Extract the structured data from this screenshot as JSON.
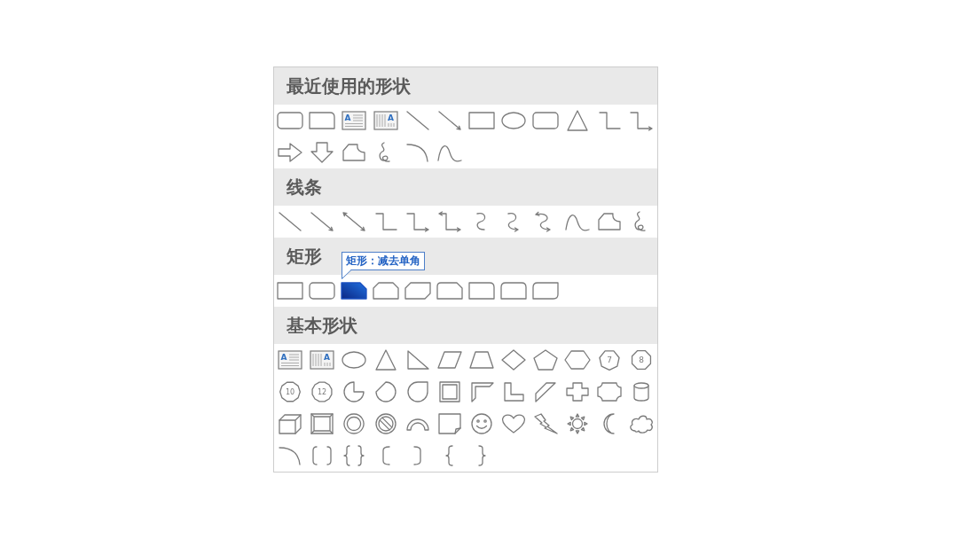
{
  "sections": [
    {
      "title": "最近使用的形状",
      "shapes": [
        {
          "kind": "roundrect",
          "selected": false
        },
        {
          "kind": "round1",
          "selected": false
        },
        {
          "kind": "textbox",
          "label": "A",
          "selected": false
        },
        {
          "kind": "vtextbox",
          "label": "A",
          "selected": false
        },
        {
          "kind": "line",
          "selected": false
        },
        {
          "kind": "arrow",
          "selected": false
        },
        {
          "kind": "rect",
          "selected": false
        },
        {
          "kind": "ellipse",
          "selected": false
        },
        {
          "kind": "roundrect",
          "selected": false
        },
        {
          "kind": "triangle",
          "selected": false
        },
        {
          "kind": "elbow",
          "selected": false
        },
        {
          "kind": "elbowarrow",
          "selected": false
        },
        {
          "kind": "rightarrow",
          "selected": false
        },
        {
          "kind": "downarrow",
          "selected": false
        },
        {
          "kind": "freeform",
          "selected": false
        },
        {
          "kind": "scribble",
          "selected": false
        },
        {
          "kind": "arc",
          "selected": false
        },
        {
          "kind": "curve",
          "selected": false
        }
      ]
    },
    {
      "title": "线条",
      "shapes": [
        {
          "kind": "line",
          "selected": false
        },
        {
          "kind": "arrow",
          "selected": false
        },
        {
          "kind": "doublearrow",
          "selected": false
        },
        {
          "kind": "elbow",
          "selected": false
        },
        {
          "kind": "elbowarrow",
          "selected": false
        },
        {
          "kind": "elbowdouble",
          "selected": false
        },
        {
          "kind": "curvedconn",
          "selected": false
        },
        {
          "kind": "curvedarrow",
          "selected": false
        },
        {
          "kind": "curveddouble",
          "selected": false
        },
        {
          "kind": "curve",
          "selected": false
        },
        {
          "kind": "freeform",
          "selected": false
        },
        {
          "kind": "scribble",
          "selected": false
        }
      ]
    },
    {
      "title": "矩形",
      "shapes": [
        {
          "kind": "rect",
          "selected": false
        },
        {
          "kind": "roundrect",
          "selected": false
        },
        {
          "kind": "snip1",
          "selected": true
        },
        {
          "kind": "snipsame",
          "selected": false
        },
        {
          "kind": "snipdiag",
          "selected": false
        },
        {
          "kind": "snipround",
          "selected": false
        },
        {
          "kind": "round1",
          "selected": false
        },
        {
          "kind": "round2same",
          "selected": false
        },
        {
          "kind": "round2diag",
          "selected": false
        }
      ]
    },
    {
      "title": "基本形状",
      "shapes": [
        {
          "kind": "textbox",
          "label": "A",
          "selected": false
        },
        {
          "kind": "vtextbox",
          "label": "A",
          "selected": false
        },
        {
          "kind": "ellipse",
          "selected": false
        },
        {
          "kind": "triangle",
          "selected": false
        },
        {
          "kind": "righttriangle",
          "selected": false
        },
        {
          "kind": "parallelogram",
          "selected": false
        },
        {
          "kind": "trapezoid",
          "selected": false
        },
        {
          "kind": "diamond",
          "selected": false
        },
        {
          "kind": "pentagon",
          "selected": false
        },
        {
          "kind": "hexagon",
          "selected": false
        },
        {
          "kind": "heptagon",
          "label": "7",
          "selected": false
        },
        {
          "kind": "octagon",
          "label": "8",
          "selected": false
        },
        {
          "kind": "decagon",
          "label": "10",
          "selected": false
        },
        {
          "kind": "dodecagon",
          "label": "12",
          "selected": false
        },
        {
          "kind": "pie",
          "selected": false
        },
        {
          "kind": "chord",
          "selected": false
        },
        {
          "kind": "teardrop",
          "selected": false
        },
        {
          "kind": "frame",
          "selected": false
        },
        {
          "kind": "halfframe",
          "selected": false
        },
        {
          "kind": "lshape",
          "selected": false
        },
        {
          "kind": "diagstripe",
          "selected": false
        },
        {
          "kind": "plus",
          "selected": false
        },
        {
          "kind": "plaque",
          "selected": false
        },
        {
          "kind": "can",
          "selected": false
        },
        {
          "kind": "cube",
          "selected": false
        },
        {
          "kind": "bevel",
          "selected": false
        },
        {
          "kind": "donut",
          "selected": false
        },
        {
          "kind": "nosymbol",
          "selected": false
        },
        {
          "kind": "blockarc",
          "selected": false
        },
        {
          "kind": "foldedcorner",
          "selected": false
        },
        {
          "kind": "smiley",
          "selected": false
        },
        {
          "kind": "heart",
          "selected": false
        },
        {
          "kind": "lightning",
          "selected": false
        },
        {
          "kind": "sun",
          "selected": false
        },
        {
          "kind": "moon",
          "selected": false
        },
        {
          "kind": "cloud",
          "selected": false
        },
        {
          "kind": "arc",
          "selected": false
        },
        {
          "kind": "bracketpair",
          "selected": false
        },
        {
          "kind": "bracepair",
          "selected": false
        },
        {
          "kind": "leftbracket",
          "selected": false
        },
        {
          "kind": "rightbracket",
          "selected": false
        },
        {
          "kind": "leftbrace",
          "selected": false
        },
        {
          "kind": "rightbrace",
          "selected": false
        }
      ]
    }
  ],
  "tooltip": {
    "text": "矩形：减去单角"
  }
}
